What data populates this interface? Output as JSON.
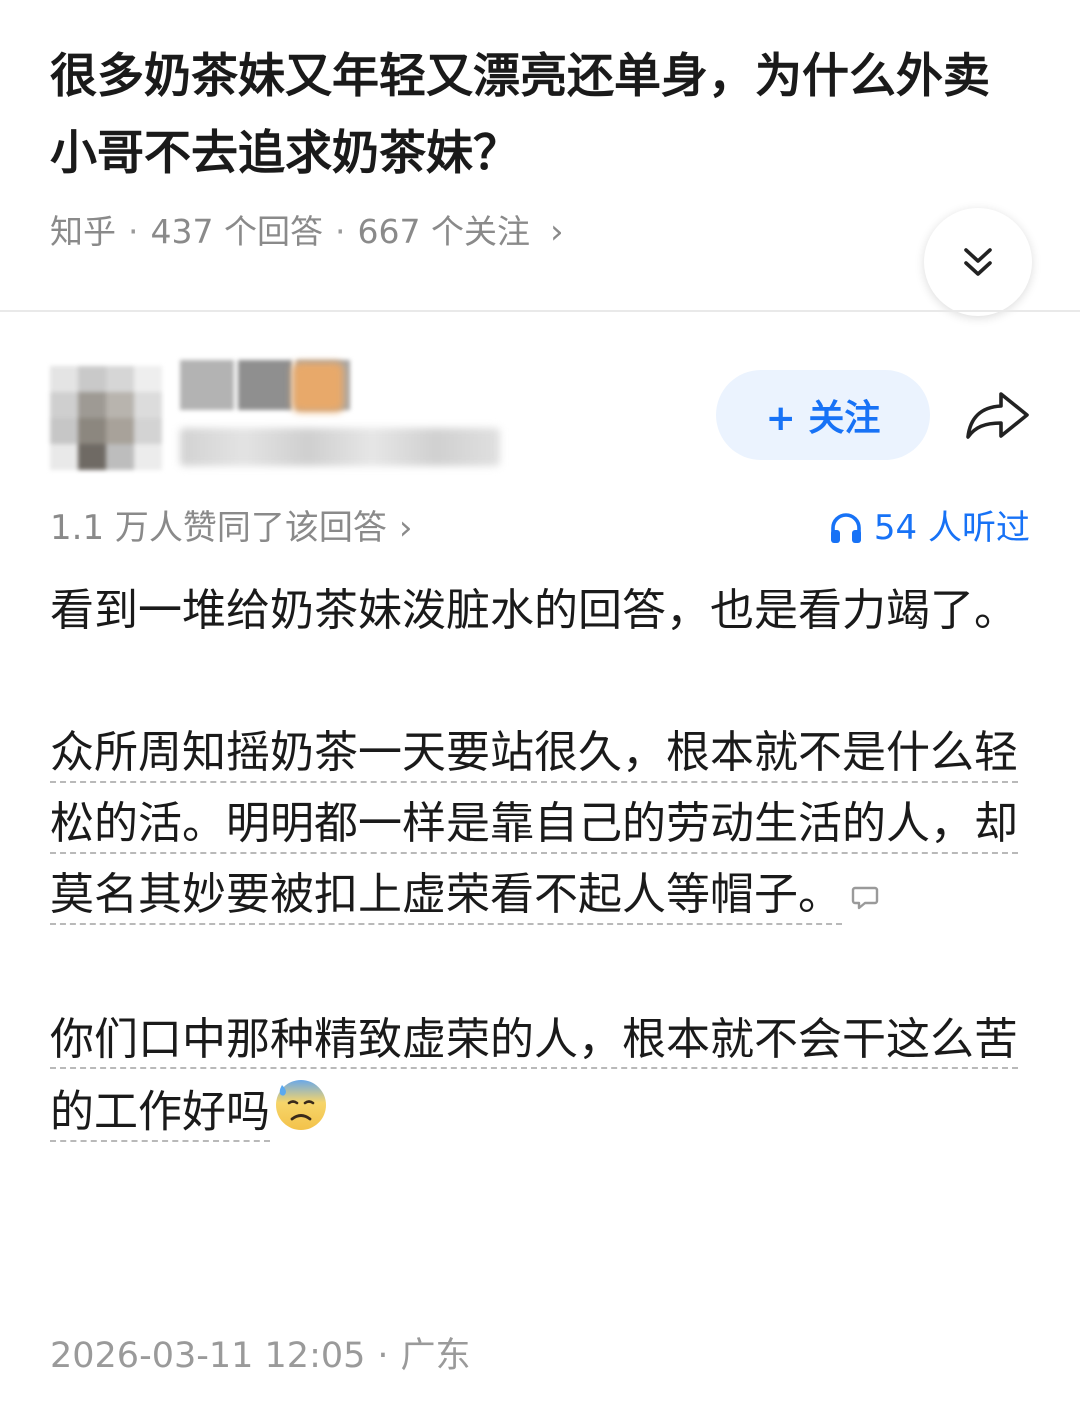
{
  "question": {
    "title": "很多奶茶妹又年轻又漂亮还单身，为什么外卖小哥不去追求奶茶妹？",
    "source": "知乎",
    "answers_count": "437 个回答",
    "followers_count": "667 个关注",
    "separator": "·",
    "chevron": "›"
  },
  "author": {
    "follow_label": "+ 关注"
  },
  "stats": {
    "votes_text": "1.1 万人赞同了该回答",
    "votes_chevron": "›",
    "listened_text": "54 人听过"
  },
  "answer": {
    "p1": "看到一堆给奶茶妹泼脏水的回答，也是看力竭了。",
    "p2": "众所周知摇奶茶一天要站很久，根本就不是什么轻松的活。明明都一样是靠自己的劳动生活的人，却莫名其妙要被扣上虚荣看不起人等帽子。",
    "p3": "你们口中那种精致虚荣的人，根本就不会干这么苦的工作好吗"
  },
  "footer": {
    "datetime": "2026-03-11 12:05",
    "separator": "·",
    "location": "广东"
  },
  "colors": {
    "accent": "#1772f6",
    "follow_bg": "#ebf3fe",
    "meta_text": "#8a8a8a"
  },
  "icons": {
    "collapse": "double-chevron-down-icon",
    "share": "share-arrow-icon",
    "listen": "headphones-icon",
    "comment": "comment-bubble-icon",
    "emoji": "anxious-face-with-sweat-emoji"
  }
}
